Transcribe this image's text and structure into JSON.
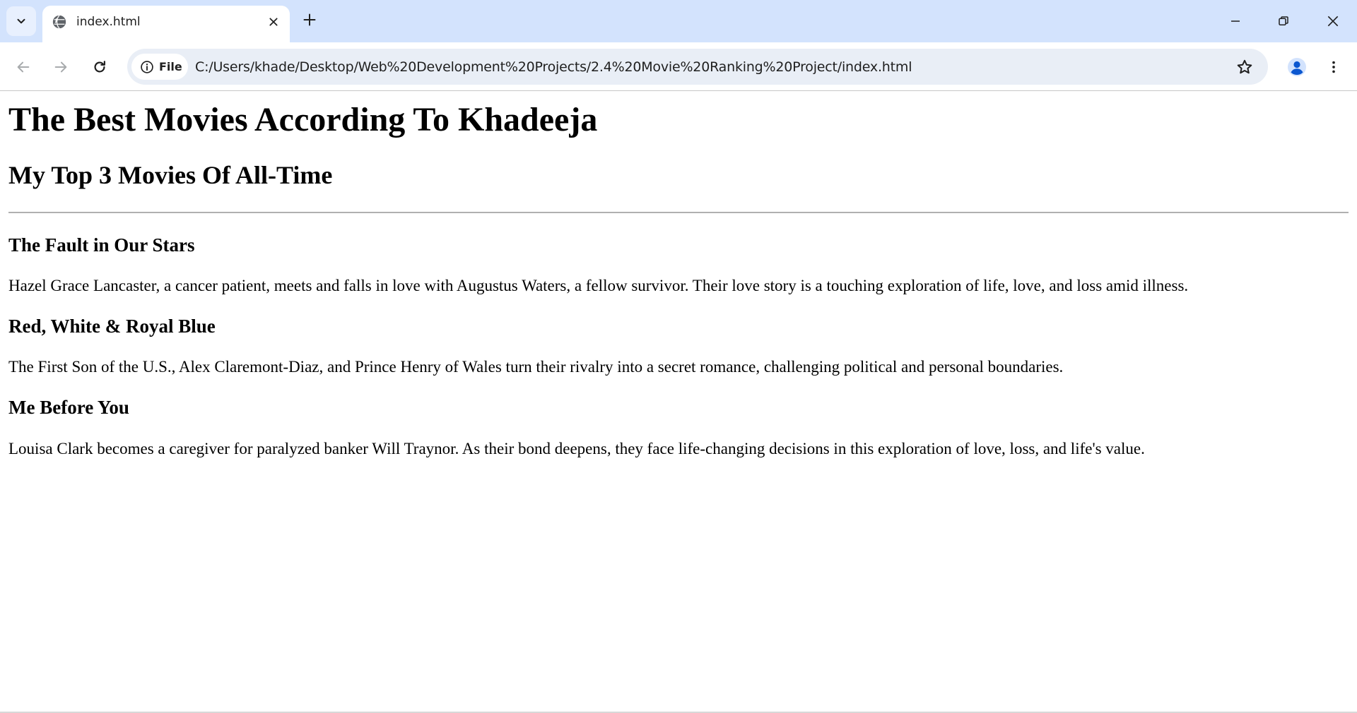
{
  "browser": {
    "tab": {
      "title": "index.html",
      "favicon_icon": "globe-icon",
      "close_icon": "close-icon"
    },
    "new_tab_icon": "plus-icon",
    "tab_search_icon": "chevron-down-icon",
    "window_controls": [
      "minimize-icon",
      "restore-icon",
      "close-icon"
    ],
    "nav": {
      "back_icon": "arrow-left-icon",
      "forward_icon": "arrow-right-icon",
      "reload_icon": "reload-icon"
    },
    "omnibox": {
      "chip_label": "File",
      "chip_icon": "info-icon",
      "url": "C:/Users/khade/Desktop/Web%20Development%20Projects/2.4%20Movie%20Ranking%20Project/index.html",
      "bookmark_icon": "star-icon"
    },
    "profile_icon": "person-icon",
    "menu_icon": "more-vert-icon"
  },
  "page": {
    "heading": "The Best Movies According To Khadeeja",
    "subheading": "My Top 3 Movies Of All-Time",
    "movies": [
      {
        "title": "The Fault in Our Stars",
        "description": "Hazel Grace Lancaster, a cancer patient, meets and falls in love with Augustus Waters, a fellow survivor. Their love story is a touching exploration of life, love, and loss amid illness."
      },
      {
        "title": "Red, White & Royal Blue",
        "description": "The First Son of the U.S., Alex Claremont-Diaz, and Prince Henry of Wales turn their rivalry into a secret romance, challenging political and personal boundaries."
      },
      {
        "title": "Me Before You",
        "description": "Louisa Clark becomes a caregiver for paralyzed banker Will Traynor. As their bond deepens, they face life-changing decisions in this exploration of love, loss, and life's value."
      }
    ]
  },
  "colors": {
    "tabstrip_bg": "#d3e3fd",
    "omnibox_bg": "#e9eef6",
    "icon_color": "#444746",
    "profile_accent": "#0b57d0"
  }
}
